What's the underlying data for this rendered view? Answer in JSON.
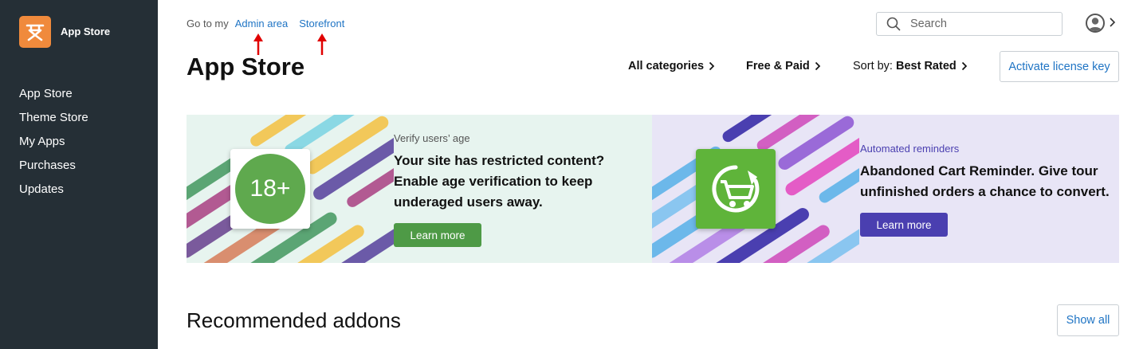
{
  "sidebar": {
    "app_title": "App Store",
    "logo_icon": "cs-cart-logo-icon",
    "items": [
      {
        "label": "App Store"
      },
      {
        "label": "Theme Store"
      },
      {
        "label": "My Apps"
      },
      {
        "label": "Purchases"
      },
      {
        "label": "Updates"
      }
    ]
  },
  "header": {
    "goto_prefix": "Go to my",
    "admin_link": "Admin area",
    "storefront_link": "Storefront",
    "search_placeholder": "Search",
    "page_title": "App Store",
    "filter_categories": "All categories",
    "filter_price": "Free & Paid",
    "sort_prefix": "Sort by:",
    "sort_value": "Best Rated",
    "license_button": "Activate license key"
  },
  "banners": [
    {
      "overline": "Verify users’ age",
      "headline": "Your site has restricted content? Enable age verification to keep underaged users away.",
      "badge": "18+",
      "button": "Learn more",
      "accent": "#4e9a46"
    },
    {
      "overline": "Automated reminders",
      "headline": "Abandoned Cart Reminder. Give tour unfinished orders a chance to convert.",
      "button": "Learn more",
      "accent": "#4a3fb0"
    }
  ],
  "recommended": {
    "title": "Recommended addons",
    "show_all": "Show all"
  },
  "colors": {
    "sidebar_bg": "#252f36",
    "link": "#1f74c4",
    "logo_bg": "#f08a3c",
    "annotation_arrow": "#e00000"
  }
}
